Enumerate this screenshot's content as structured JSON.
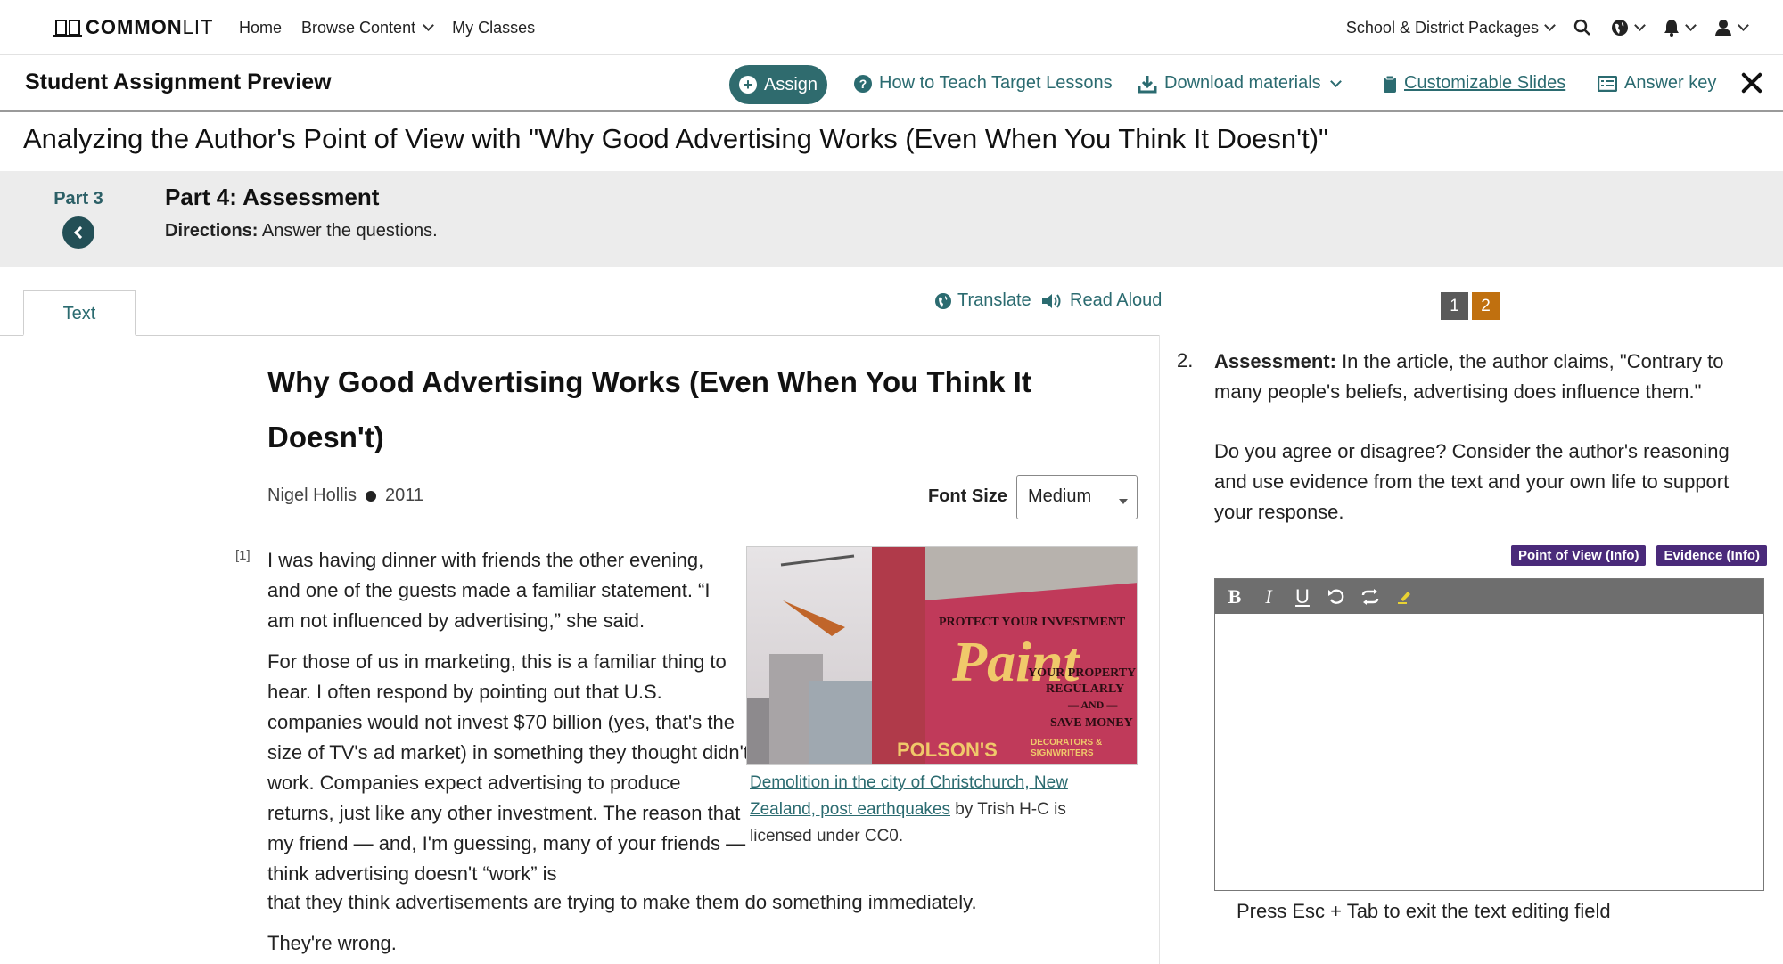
{
  "topnav": {
    "logo": {
      "bold": "COMMON",
      "light": "LIT"
    },
    "links": [
      "Home",
      "Browse Content",
      "My Classes"
    ],
    "packages_label": "School & District Packages"
  },
  "preview": {
    "title": "Student Assignment Preview",
    "assign_label": "Assign",
    "how_to_label": "How to Teach Target Lessons",
    "download_label": "Download materials",
    "slides_label": "Customizable Slides",
    "answer_key_label": "Answer key"
  },
  "lesson": {
    "title": "Analyzing the Author's Point of View with \"Why Good Advertising Works (Even When You Think It Doesn't)\"",
    "prev_part_label": "Part 3",
    "part_title": "Part 4: Assessment",
    "directions_label": "Directions:",
    "directions_text": " Answer the questions."
  },
  "reader": {
    "tab_label": "Text",
    "translate_label": "Translate",
    "read_aloud_label": "Read Aloud",
    "article_title": "Why Good Advertising Works (Even When You Think It Doesn't)",
    "author": "Nigel Hollis",
    "year": "2011",
    "font_size_label": "Font Size",
    "font_size_value": "Medium",
    "para_number": "[1]",
    "p1": "I was having dinner with friends the other evening, and one of the guests made a familiar statement. “I am not influenced by advertising,” she said.",
    "p2": "For those of us in marketing, this is a familiar thing to hear. I often respond by pointing out that U.S. companies would not invest $70 billion (yes, that's the size of TV's ad market) in something they thought didn't work. Companies expect advertising to produce returns, just like any other investment. The reason that my friend — and, I'm guessing, many of your friends — think advertising doesn't “work” is",
    "p2_tail": "that they think advertisements are trying to make them do something immediately.",
    "p3": "They're wrong.",
    "caption_link": "Demolition in the city of Christchurch, New Zealand, post earthquakes",
    "caption_rest": " by Trish H-C is licensed under CC0.",
    "sign_lines": {
      "top": "PROTECT YOUR INVESTMENT",
      "main": "Paint",
      "r1": "YOUR PROPERTY",
      "r2": "REGULARLY",
      "r3": "— AND —",
      "r4": "SAVE MONEY",
      "brand": "POLSON'S",
      "brand_sub1": "DECORATORS &",
      "brand_sub2": "SIGNWRITERS"
    }
  },
  "question": {
    "nav": [
      {
        "label": "1",
        "color": "#5a5a5a"
      },
      {
        "label": "2",
        "color": "#c0700f"
      }
    ],
    "index": "2.",
    "prompt_label": "Assessment:",
    "prompt_text": " In the article, the author claims, \"Contrary to many people's beliefs, advertising does influence them.\"",
    "prompt_2": "Do you agree or disagree? Consider the author's reasoning and use evidence from the text and your own life to support your response.",
    "tags": [
      "Point of View (Info)",
      "Evidence (Info)"
    ],
    "editor_hint": "Press Esc + Tab to exit the text editing field"
  },
  "colors": {
    "accent": "#2b6b70",
    "assign_bg": "#2f6b6e",
    "tag_bg": "#4a2a7a",
    "band_bg": "#ececec"
  }
}
